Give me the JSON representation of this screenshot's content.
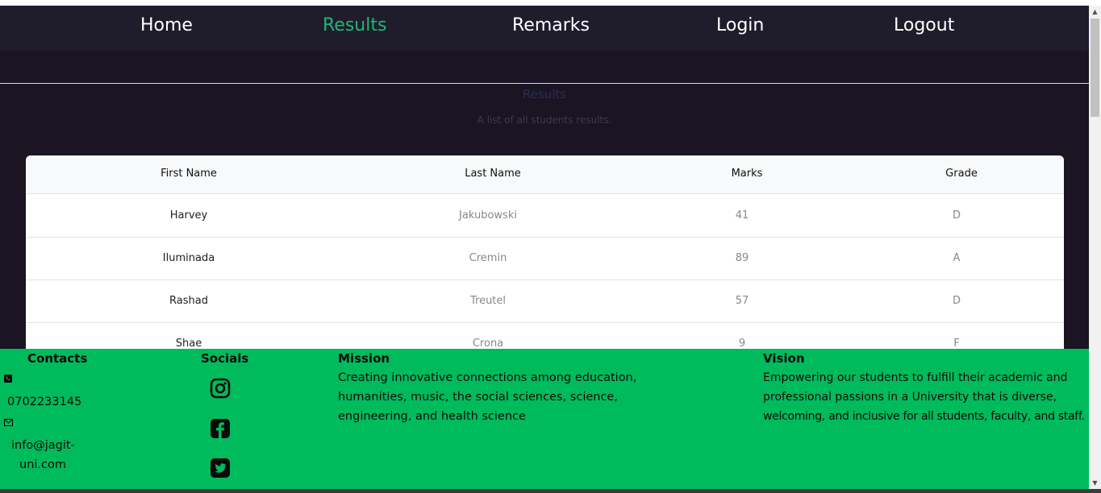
{
  "nav": {
    "items": [
      {
        "label": "Home"
      },
      {
        "label": "Results"
      },
      {
        "label": "Remarks"
      },
      {
        "label": "Login"
      },
      {
        "label": "Logout"
      }
    ],
    "active_color": "#1fb874"
  },
  "page": {
    "heading": "Results",
    "subtitle": "A list of all students results."
  },
  "table": {
    "headers": [
      "First Name",
      "Last Name",
      "Marks",
      "Grade"
    ],
    "rows": [
      [
        "Harvey",
        "Jakubowski",
        "41",
        "D"
      ],
      [
        "Iluminada",
        "Cremin",
        "89",
        "A"
      ],
      [
        "Rashad",
        "Treutel",
        "57",
        "D"
      ],
      [
        "Shae",
        "Crona",
        "9",
        "F"
      ]
    ]
  },
  "footer": {
    "background": "#00bb5c",
    "contacts": {
      "title": "Contacts",
      "phone": "0702233145",
      "email_line1": "info@jagit-",
      "email_line2": "uni.com",
      "phone_icon": "phone-icon",
      "email_icon": "envelope-icon"
    },
    "socials": {
      "title": "Socials",
      "icons": [
        "instagram-icon",
        "facebook-icon",
        "twitter-icon"
      ]
    },
    "mission": {
      "title": "Mission",
      "lines": [
        "Creating innovative connections among education,",
        "humanities, music, the social sciences, science,",
        "engineering, and health science"
      ]
    },
    "vision": {
      "title": "Vision",
      "lines": [
        "Empowering our students to fulfill their academic and",
        "professional passions in a University that is diverse,",
        "welcoming, and inclusive for all students, faculty, and staff."
      ]
    }
  }
}
